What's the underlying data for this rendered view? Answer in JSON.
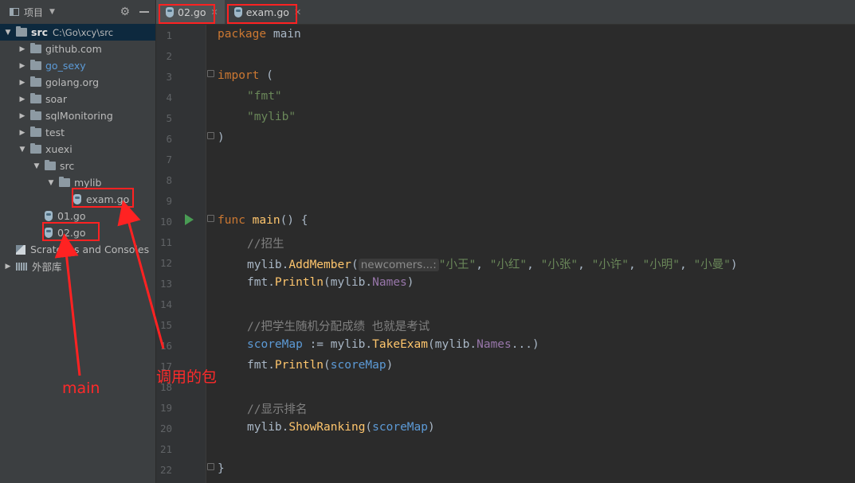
{
  "sidebar": {
    "title": "项目",
    "tree": [
      {
        "label": "src",
        "path": "C:\\Go\\xcy\\src",
        "type": "folder",
        "indent": 0,
        "expanded": true,
        "selected": true,
        "style": "bold"
      },
      {
        "label": "github.com",
        "type": "folder",
        "indent": 1,
        "expanded": false
      },
      {
        "label": "go_sexy",
        "type": "folder",
        "indent": 1,
        "expanded": false,
        "style": "blue"
      },
      {
        "label": "golang.org",
        "type": "folder",
        "indent": 1,
        "expanded": false
      },
      {
        "label": "soar",
        "type": "folder",
        "indent": 1,
        "expanded": false
      },
      {
        "label": "sqlMonitoring",
        "type": "folder",
        "indent": 1,
        "expanded": false
      },
      {
        "label": "test",
        "type": "folder",
        "indent": 1,
        "expanded": false
      },
      {
        "label": "xuexi",
        "type": "folder",
        "indent": 1,
        "expanded": true
      },
      {
        "label": "src",
        "type": "folder",
        "indent": 2,
        "expanded": true
      },
      {
        "label": "mylib",
        "type": "folder",
        "indent": 3,
        "expanded": true
      },
      {
        "label": "exam.go",
        "type": "file",
        "indent": 4
      },
      {
        "label": "01.go",
        "type": "file",
        "indent": 2
      },
      {
        "label": "02.go",
        "type": "file",
        "indent": 2
      },
      {
        "label": "Scratches and Consoles",
        "type": "scratch",
        "indent": 0
      },
      {
        "label": "外部库",
        "type": "lib",
        "indent": 0,
        "expanded": false
      }
    ]
  },
  "tabs": [
    {
      "label": "02.go",
      "active": true
    },
    {
      "label": "exam.go",
      "active": false
    }
  ],
  "editor": {
    "line_numbers": [
      "1",
      "2",
      "3",
      "4",
      "5",
      "6",
      "7",
      "8",
      "9",
      "10",
      "11",
      "12",
      "13",
      "14",
      "15",
      "16",
      "17",
      "18",
      "19",
      "20",
      "21",
      "22"
    ],
    "code": {
      "l1_kw": "package",
      "l1_rest": " main",
      "l3_kw": "import",
      "l3_rest": " (",
      "l4": "\"fmt\"",
      "l5": "\"mylib\"",
      "l6": ")",
      "l10_kw": "func",
      "l10_fn": "main",
      "l10_rest": "() {",
      "l11": "//招生",
      "l12_pkg": "mylib.",
      "l12_fn": "AddMember",
      "l12_open": "(",
      "l12_hint": "newcomers...:",
      "l12_s1": "\"小王\"",
      "l12_s2": "\"小红\"",
      "l12_s3": "\"小张\"",
      "l12_s4": "\"小许\"",
      "l12_s5": "\"小明\"",
      "l12_s6": "\"小曼\"",
      "l12_sep": ", ",
      "l12_close": ")",
      "l13_pkg": "fmt.",
      "l13_fn": "Println",
      "l13_a": "(mylib.",
      "l13_var": "Names",
      "l13_close": ")",
      "l15": "//把学生随机分配成绩 也就是考试",
      "l16_var": "scoreMap",
      "l16_op": " := mylib.",
      "l16_fn": "TakeExam",
      "l16_a": "(mylib.",
      "l16_var2": "Names",
      "l16_close": "...)",
      "l17_pkg": "fmt.",
      "l17_fn": "Println",
      "l17_open": "(",
      "l17_var": "scoreMap",
      "l17_close": ")",
      "l19": "//显示排名",
      "l20_pkg": "mylib.",
      "l20_fn": "ShowRanking",
      "l20_open": "(",
      "l20_var": "scoreMap",
      "l20_close": ")",
      "l22": "}"
    }
  },
  "annotations": {
    "main_label": "main",
    "pkg_label": "调用的包",
    "color": "#ff2222"
  }
}
